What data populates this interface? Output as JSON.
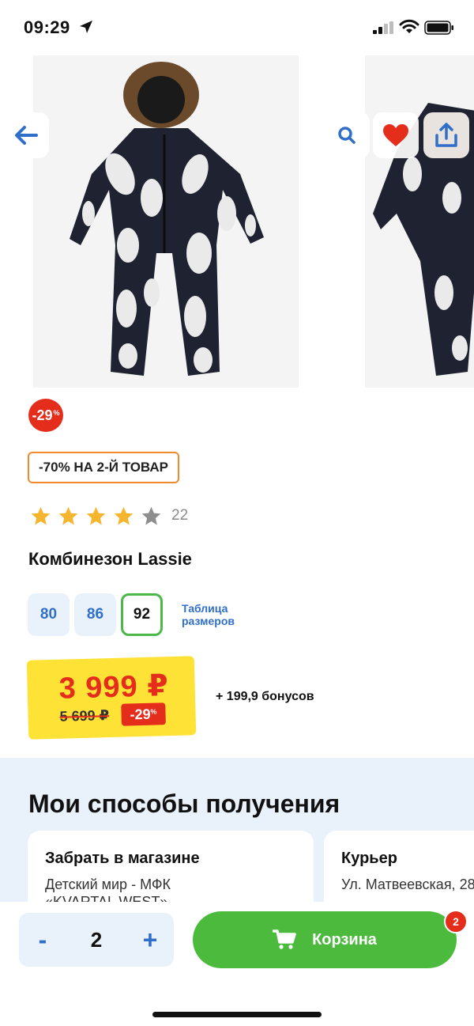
{
  "status": {
    "time": "09:29",
    "icons": [
      "location-arrow-icon",
      "signal-icon",
      "wifi-icon",
      "battery-icon"
    ]
  },
  "toolbar": {
    "icons": [
      "back-arrow-icon",
      "search-icon",
      "heart-icon",
      "share-icon"
    ]
  },
  "product": {
    "discount_badge": "-29",
    "discount_suffix": "%",
    "promo": "-70% НА 2-Й ТОВАР",
    "rating": {
      "stars": 4,
      "max": 5,
      "count": "22"
    },
    "title": "Комбинезон Lassie",
    "sizes": [
      {
        "label": "80",
        "selected": false
      },
      {
        "label": "86",
        "selected": false
      },
      {
        "label": "92",
        "selected": true
      }
    ],
    "size_table_label": "Таблица размеров",
    "price": {
      "current": "3 999 ₽",
      "old": "5 699 ₽",
      "discount": "-29",
      "discount_suffix": "%"
    },
    "bonus": "+ 199,9 бонусов"
  },
  "delivery": {
    "title": "Мои способы получения",
    "cards": [
      {
        "title": "Забрать в магазине",
        "text1": "Детский мир - МФК",
        "text2": "«KVARTAL WEST»"
      },
      {
        "title": "Курьер",
        "text1": "Ул. Матвеевская, 28"
      }
    ]
  },
  "cart": {
    "minus": "-",
    "quantity": "2",
    "plus": "+",
    "button_label": "Корзина",
    "badge": "2"
  },
  "colors": {
    "accent_blue": "#2f6fc9",
    "green": "#4cbb3d",
    "red": "#e52d1c",
    "yellow": "#ffe236",
    "star": "#f5b52e"
  }
}
